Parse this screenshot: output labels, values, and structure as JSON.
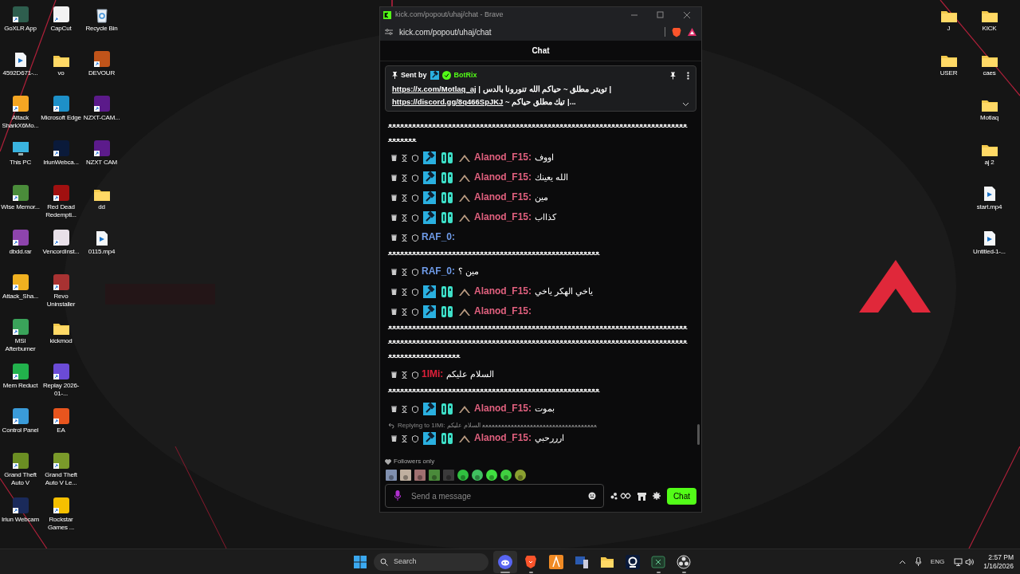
{
  "desktop": {
    "left_columns": [
      [
        {
          "label": "GoXLR App",
          "kind": "app",
          "color": "#2e5e4e"
        },
        {
          "label": "4592D671-...",
          "kind": "video"
        },
        {
          "label": "Attack SharkX6Mo...",
          "kind": "app",
          "color": "#f5a623"
        },
        {
          "label": "This PC",
          "kind": "monitor"
        },
        {
          "label": "Wise Memor...",
          "kind": "app",
          "color": "#4a8c3a"
        },
        {
          "label": "dbdd.rar",
          "kind": "app",
          "color": "#8e44ad"
        },
        {
          "label": "Attack_Sha...",
          "kind": "app",
          "color": "#f0b020"
        },
        {
          "label": "MSI Afterburner",
          "kind": "app",
          "color": "#3aa35a"
        },
        {
          "label": "Mem Reduct",
          "kind": "app",
          "color": "#22b14c"
        },
        {
          "label": "Control Panel",
          "kind": "app",
          "color": "#3a9bd9"
        },
        {
          "label": "Grand Theft Auto V",
          "kind": "app",
          "color": "#6b8e23"
        },
        {
          "label": "Iriun Webcam",
          "kind": "app",
          "color": "#1a2a5a"
        }
      ],
      [
        {
          "label": "CapCut",
          "kind": "app",
          "color": "#f2f2f2"
        },
        {
          "label": "vo",
          "kind": "folder"
        },
        {
          "label": "Microsoft Edge",
          "kind": "app",
          "color": "#1e90c8"
        },
        {
          "label": "IriunWebca...",
          "kind": "app",
          "color": "#0a1a3a"
        },
        {
          "label": "Red Dead Redempti...",
          "kind": "app",
          "color": "#a01010"
        },
        {
          "label": "VencordInst...",
          "kind": "app",
          "color": "#e8e0e8"
        },
        {
          "label": "Revo Uninstaller",
          "kind": "app",
          "color": "#a83232"
        },
        {
          "label": "kickmod",
          "kind": "folder"
        },
        {
          "label": "Replay 2026-01-...",
          "kind": "app",
          "color": "#6b4bd6"
        },
        {
          "label": "EA",
          "kind": "app",
          "color": "#e8551e"
        },
        {
          "label": "Grand Theft Auto V Le...",
          "kind": "app",
          "color": "#7a9a2a"
        },
        {
          "label": "Rockstar Games ...",
          "kind": "app",
          "color": "#f6c000"
        }
      ],
      [
        {
          "label": "Recycle Bin",
          "kind": "recycle"
        },
        {
          "label": "DEVOUR",
          "kind": "app",
          "color": "#c0541a"
        },
        {
          "label": "NZXT-CAM...",
          "kind": "app",
          "color": "#5b1a8a"
        },
        {
          "label": "NZXT CAM",
          "kind": "app",
          "color": "#5c1b8b"
        },
        {
          "label": "dd",
          "kind": "folder"
        },
        {
          "label": "0115.mp4",
          "kind": "video"
        }
      ]
    ],
    "right_columns": [
      [
        {
          "label": "J",
          "kind": "folder"
        },
        {
          "label": "USER",
          "kind": "folder"
        }
      ],
      [
        {
          "label": "KICK",
          "kind": "folder"
        },
        {
          "label": "caes",
          "kind": "folder"
        },
        {
          "label": "Motlaq",
          "kind": "folder"
        },
        {
          "label": "aj 2",
          "kind": "folder"
        },
        {
          "label": "start.mp4",
          "kind": "video"
        },
        {
          "label": "Untitled-1-...",
          "kind": "video"
        }
      ]
    ]
  },
  "browser": {
    "title": "kick.com/popout/uhaj/chat - Brave",
    "url": "kick.com/popout/uhaj/chat"
  },
  "chat": {
    "header": "Chat",
    "pinned": {
      "sent_by": "Sent by",
      "sender": "BotRix",
      "lines": [
        {
          "link": "https://x.com/Motlaq_aj",
          "text": "| تويتر مطلق ~ حياكم الله تنورونا بالدس |"
        },
        {
          "link": "https://discord.gg/8q466SpJKJ",
          "text": "~ تيك مطلق حياكم |..."
        }
      ]
    },
    "messages": [
      {
        "kind": "overflow",
        "extra": "ﻌﻌﻌﻌﻌﻌﻌﻌﻌﻌﻌﻌﻌﻌﻌﻌﻌﻌﻌﻌﻌﻌﻌﻌﻌﻌﻌﻌﻌﻌﻌﻌﻌﻌﻌﻌﻌﻌﻌﻌﻌﻌﻌﻌﻌﻌﻌﻌﻌﻌﻌﻌﻌﻌﻌﻌﻌﻌﻌﻌﻌﻌﻌﻌﻌﻌﻌﻌﻌﻌﻌﻌﻌﻌﻌﻌﻌﻌﻌﻌﻌﻌ"
      },
      {
        "kind": "message",
        "user": "Alanod_F15:",
        "color": "#e0607e",
        "badged": true,
        "text": "اووف"
      },
      {
        "kind": "message",
        "user": "Alanod_F15:",
        "color": "#e0607e",
        "badged": true,
        "text": "الله يعينك"
      },
      {
        "kind": "message",
        "user": "Alanod_F15:",
        "color": "#e0607e",
        "badged": true,
        "text": "مين"
      },
      {
        "kind": "message",
        "user": "Alanod_F15:",
        "color": "#e0607e",
        "badged": true,
        "text": "كذااب"
      },
      {
        "kind": "message",
        "user": "RAF_0:",
        "color": "#6f9be8",
        "badged": false,
        "extra": "ﻌﻌﻌﻌﻌﻌﻌﻌﻌﻌﻌﻌﻌﻌﻌﻌﻌﻌﻌﻌﻌﻌﻌﻌﻌﻌﻌﻌﻌﻌﻌﻌﻌﻌﻌﻌﻌﻌﻌﻌﻌﻌﻌﻌﻌﻌﻌﻌﻌﻌﻌﻌﻌ"
      },
      {
        "kind": "message",
        "user": "RAF_0:",
        "color": "#6f9be8",
        "badged": false,
        "text": "مين ؟"
      },
      {
        "kind": "message",
        "user": "Alanod_F15:",
        "color": "#e0607e",
        "badged": true,
        "text": "ياخي الهكر ياخي"
      },
      {
        "kind": "message",
        "user": "Alanod_F15:",
        "color": "#e0607e",
        "badged": true,
        "extra": "ﻌﻌﻌﻌﻌﻌﻌﻌﻌﻌﻌﻌﻌﻌﻌﻌﻌﻌﻌﻌﻌﻌﻌﻌﻌﻌﻌﻌﻌﻌﻌﻌﻌﻌﻌﻌﻌﻌﻌﻌﻌﻌﻌﻌﻌﻌﻌﻌﻌﻌﻌﻌﻌﻌﻌﻌﻌﻌﻌﻌﻌﻌﻌﻌﻌﻌﻌﻌﻌﻌﻌﻌﻌﻌﻌﻌﻌﻌﻌﻌﻌﻌﻌﻌﻌﻌﻌﻌﻌﻌﻌﻌﻌﻌﻌﻌﻌﻌﻌﻌﻌﻌﻌﻌﻌﻌﻌﻌﻌﻌﻌﻌﻌﻌﻌﻌﻌﻌﻌﻌﻌﻌﻌﻌﻌﻌﻌﻌﻌﻌﻌﻌﻌﻌﻌﻌﻌﻌﻌﻌﻌﻌﻌﻌﻌﻌﻌﻌﻌﻌﻌﻌﻌﻌﻌﻌﻌﻌﻌﻌﻌﻌﻌﻌﻌﻌﻌﻌ"
      },
      {
        "kind": "message",
        "user": "1IMi:",
        "color": "#e0203a",
        "badged": false,
        "text": "السلام عليكم",
        "extra": "ﻌﻌﻌﻌﻌﻌﻌﻌﻌﻌﻌﻌﻌﻌﻌﻌﻌﻌﻌﻌﻌﻌﻌﻌﻌﻌﻌﻌﻌﻌﻌﻌﻌﻌﻌﻌﻌﻌﻌﻌﻌﻌﻌﻌﻌﻌﻌﻌﻌﻌﻌﻌﻌ"
      },
      {
        "kind": "message",
        "user": "Alanod_F15:",
        "color": "#e0607e",
        "badged": true,
        "text": "بموت"
      },
      {
        "kind": "message",
        "user": "Alanod_F15:",
        "color": "#e0607e",
        "badged": true,
        "text": "ارررحبي",
        "reply": {
          "label": "Replying to 1IMi:",
          "text": "ﻌﻌﻌﻌﻌﻌﻌﻌﻌﻌﻌﻌﻌﻌﻌﻌﻌﻌﻌﻌﻌﻌﻌﻌﻌﻌﻌﻌﻌﻌﻌﻌﻌﻌﻌﻌ السلام عليكم"
        }
      }
    ],
    "mode": "Followers only",
    "input": {
      "placeholder": "Send a message"
    },
    "send": "Chat"
  },
  "taskbar": {
    "search": "Search",
    "apps": [
      {
        "kind": "discord",
        "open": true,
        "selected": true
      },
      {
        "kind": "brave",
        "open": true,
        "selected": false
      },
      {
        "kind": "studio",
        "open": false,
        "selected": false
      },
      {
        "kind": "computer",
        "open": false,
        "selected": false
      },
      {
        "kind": "folder",
        "open": false,
        "selected": false
      },
      {
        "kind": "webcam",
        "open": false,
        "selected": false
      },
      {
        "kind": "sheet",
        "open": true,
        "selected": false
      },
      {
        "kind": "obs",
        "open": true,
        "selected": false
      }
    ],
    "language": "ENG",
    "time": "2:57 PM",
    "date": "1/16/2026"
  }
}
